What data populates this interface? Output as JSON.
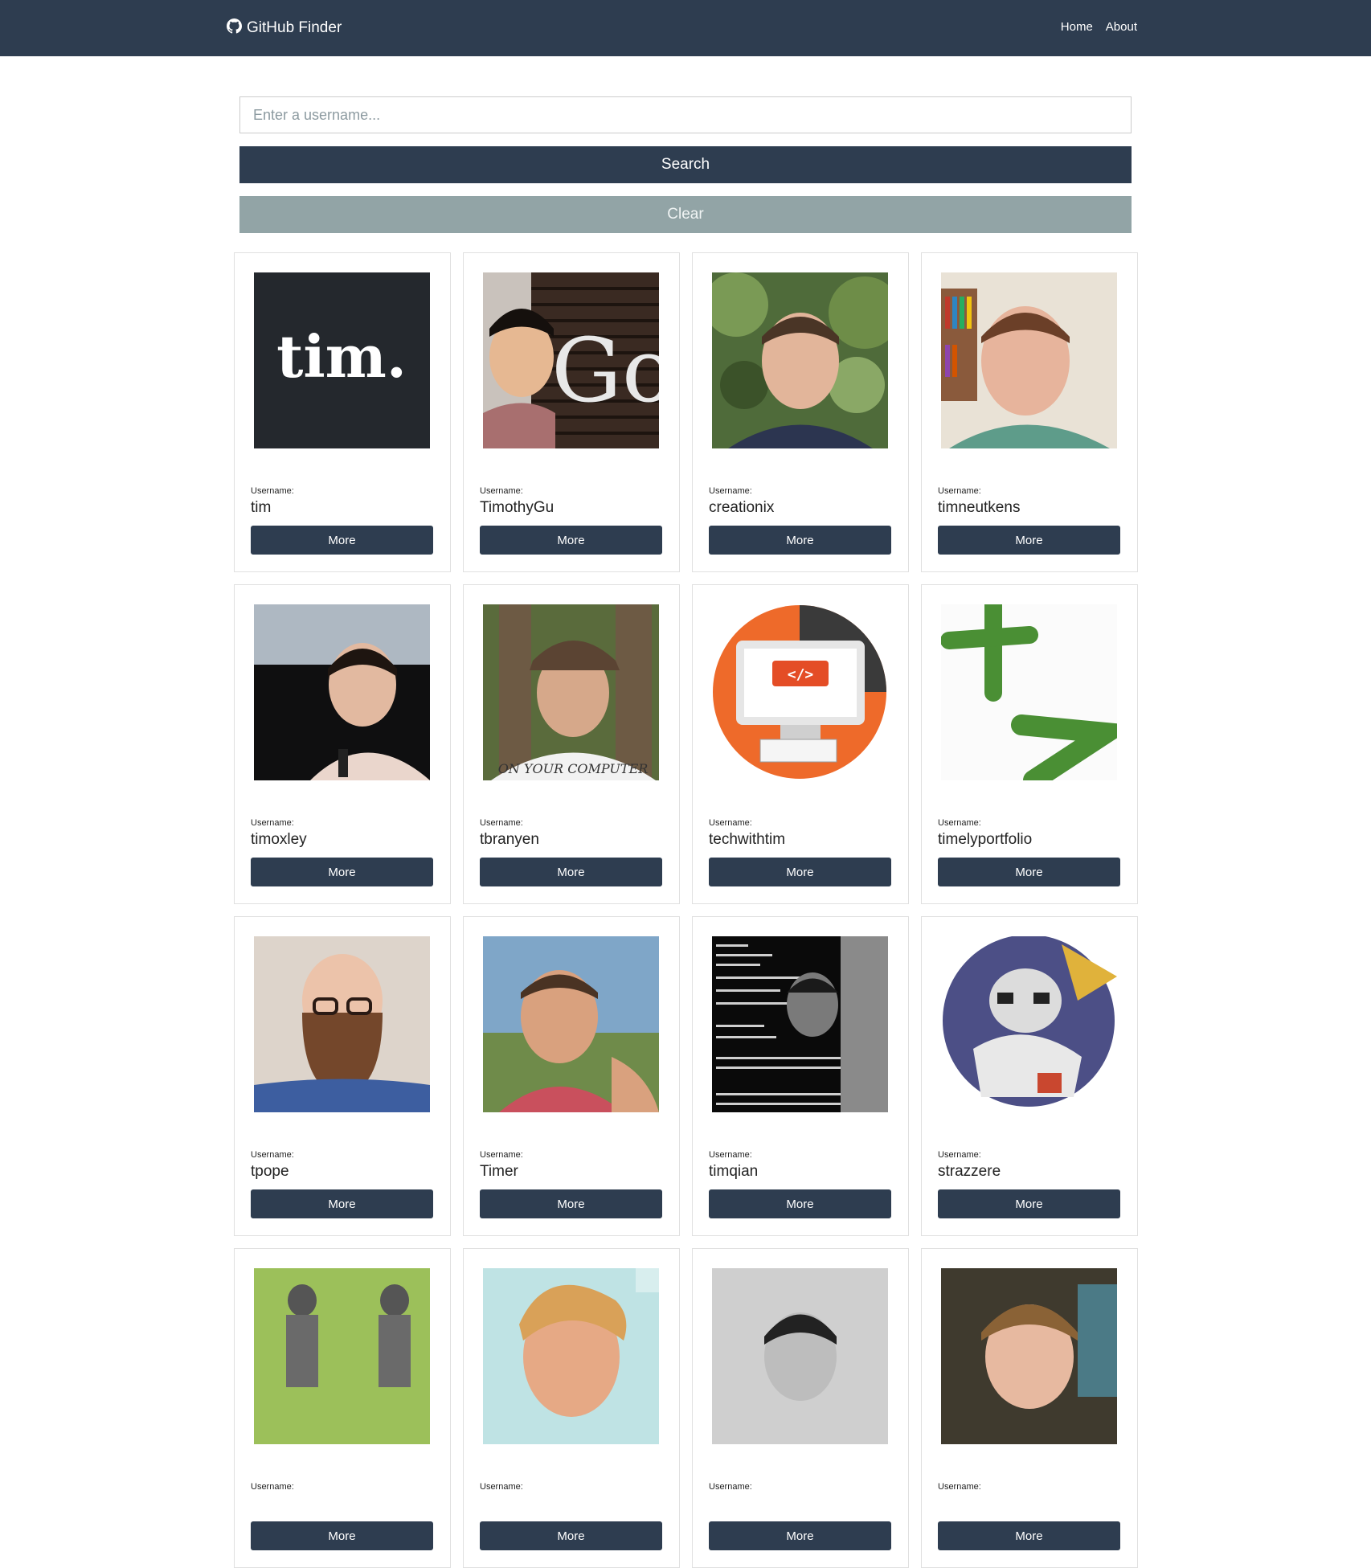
{
  "navbar": {
    "brand": "GitHub Finder",
    "links": [
      "Home",
      "About"
    ]
  },
  "search": {
    "placeholder": "Enter a username...",
    "value": "",
    "search_label": "Search",
    "clear_label": "Clear"
  },
  "users": [
    {
      "label": "Username:",
      "username": "tim",
      "button": "More",
      "avatar_text": "tim."
    },
    {
      "label": "Username:",
      "username": "TimothyGu",
      "button": "More",
      "avatar_text": "Goo"
    },
    {
      "label": "Username:",
      "username": "creationix",
      "button": "More"
    },
    {
      "label": "Username:",
      "username": "timneutkens",
      "button": "More"
    },
    {
      "label": "Username:",
      "username": "timoxley",
      "button": "More"
    },
    {
      "label": "Username:",
      "username": "tbranyen",
      "button": "More",
      "avatar_text": "ON YOUR COMPUTER"
    },
    {
      "label": "Username:",
      "username": "techwithtim",
      "button": "More",
      "avatar_text": "</>"
    },
    {
      "label": "Username:",
      "username": "timelyportfolio",
      "button": "More"
    },
    {
      "label": "Username:",
      "username": "tpope",
      "button": "More"
    },
    {
      "label": "Username:",
      "username": "Timer",
      "button": "More"
    },
    {
      "label": "Username:",
      "username": "timqian",
      "button": "More"
    },
    {
      "label": "Username:",
      "username": "strazzere",
      "button": "More"
    },
    {
      "label": "Username:",
      "username": "",
      "button": "More"
    },
    {
      "label": "Username:",
      "username": "",
      "button": "More"
    },
    {
      "label": "Username:",
      "username": "",
      "button": "More"
    },
    {
      "label": "Username:",
      "username": "",
      "button": "More"
    }
  ],
  "colors": {
    "navbar": "#2e3d50",
    "primary": "#2e3d50",
    "clear": "#92a4a6"
  },
  "icons": {
    "brand": "github-icon"
  }
}
